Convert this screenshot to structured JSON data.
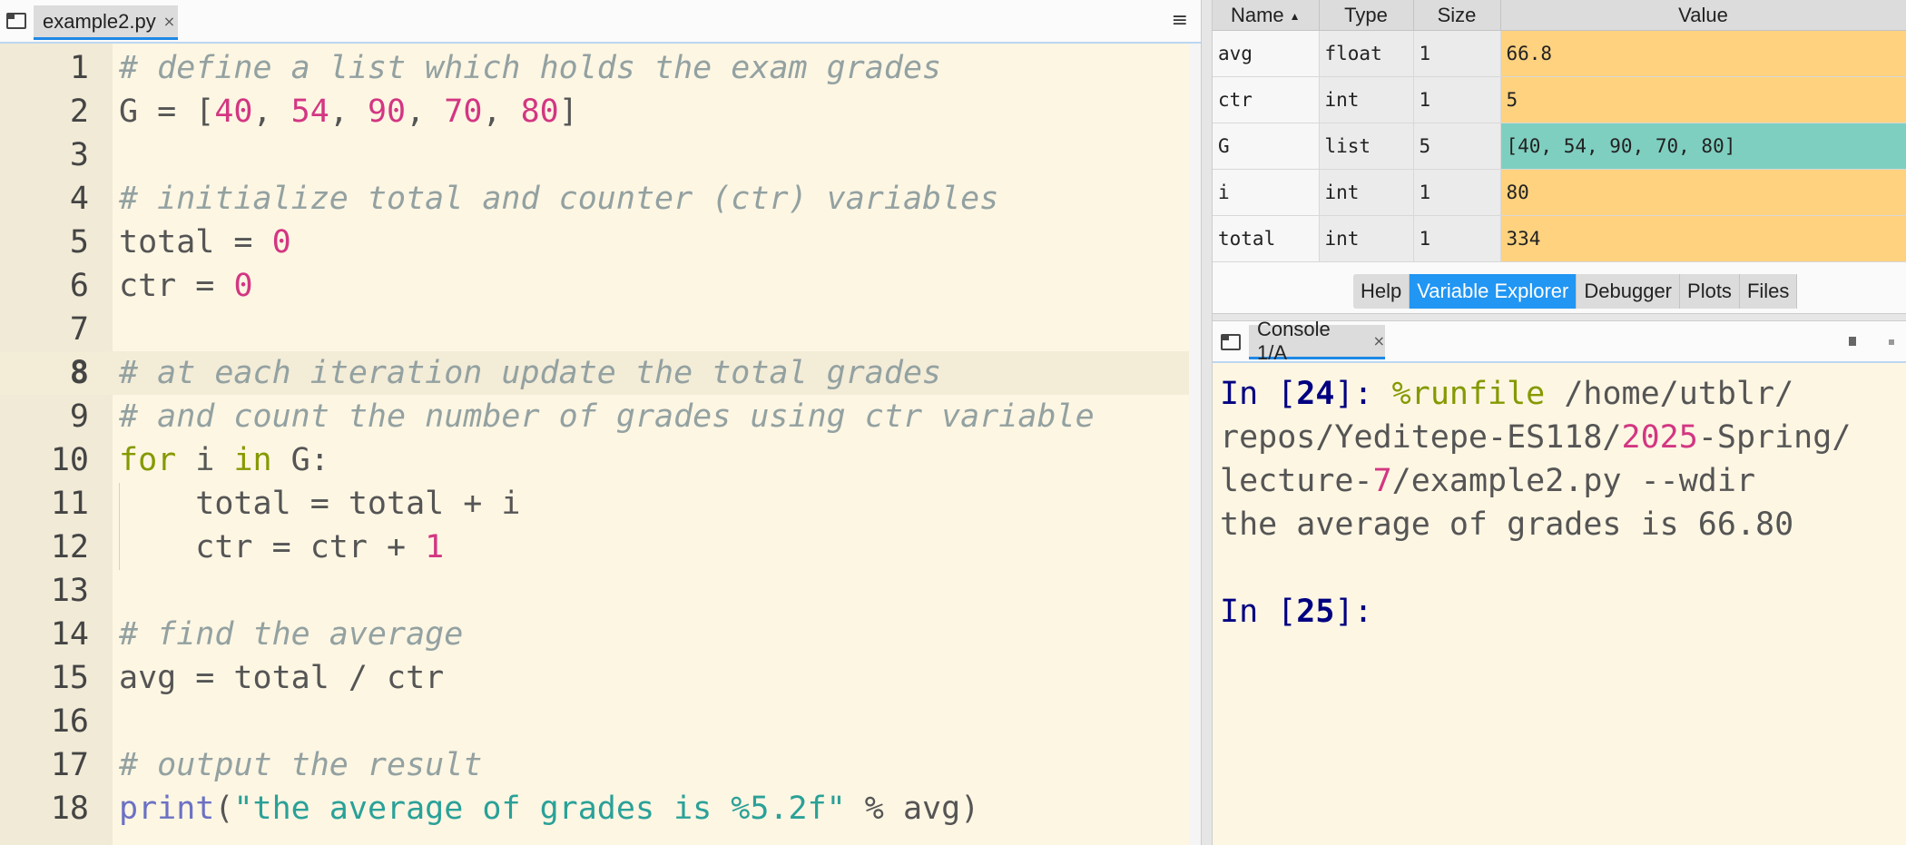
{
  "editor": {
    "tab_label": "example2.py",
    "tab_close": "×",
    "menu_icon": "≡",
    "current_line": 8,
    "lines": [
      {
        "n": "1",
        "segments": [
          {
            "t": "# define a list which holds the exam grades",
            "c": "cmt"
          }
        ]
      },
      {
        "n": "2",
        "segments": [
          {
            "t": "G = [",
            "c": ""
          },
          {
            "t": "40",
            "c": "num"
          },
          {
            "t": ", ",
            "c": ""
          },
          {
            "t": "54",
            "c": "num"
          },
          {
            "t": ", ",
            "c": ""
          },
          {
            "t": "90",
            "c": "num"
          },
          {
            "t": ", ",
            "c": ""
          },
          {
            "t": "70",
            "c": "num"
          },
          {
            "t": ", ",
            "c": ""
          },
          {
            "t": "80",
            "c": "num"
          },
          {
            "t": "]",
            "c": ""
          }
        ]
      },
      {
        "n": "3",
        "segments": []
      },
      {
        "n": "4",
        "segments": [
          {
            "t": "# initialize total and counter (ctr) variables",
            "c": "cmt"
          }
        ]
      },
      {
        "n": "5",
        "segments": [
          {
            "t": "total = ",
            "c": ""
          },
          {
            "t": "0",
            "c": "num"
          }
        ]
      },
      {
        "n": "6",
        "segments": [
          {
            "t": "ctr = ",
            "c": ""
          },
          {
            "t": "0",
            "c": "num"
          }
        ]
      },
      {
        "n": "7",
        "segments": []
      },
      {
        "n": "8",
        "segments": [
          {
            "t": "# at each iteration update the total grades",
            "c": "cmt"
          }
        ]
      },
      {
        "n": "9",
        "segments": [
          {
            "t": "# and count the number of grades using ctr variable",
            "c": "cmt"
          }
        ]
      },
      {
        "n": "10",
        "segments": [
          {
            "t": "for",
            "c": "kw"
          },
          {
            "t": " i ",
            "c": ""
          },
          {
            "t": "in",
            "c": "kw"
          },
          {
            "t": " G:",
            "c": ""
          }
        ]
      },
      {
        "n": "11",
        "segments": [
          {
            "t": "    total = total + i",
            "c": ""
          }
        ]
      },
      {
        "n": "12",
        "segments": [
          {
            "t": "    ctr = ctr + ",
            "c": ""
          },
          {
            "t": "1",
            "c": "num"
          }
        ]
      },
      {
        "n": "13",
        "segments": []
      },
      {
        "n": "14",
        "segments": [
          {
            "t": "# find the average",
            "c": "cmt"
          }
        ]
      },
      {
        "n": "15",
        "segments": [
          {
            "t": "avg = total / ctr",
            "c": ""
          }
        ]
      },
      {
        "n": "16",
        "segments": []
      },
      {
        "n": "17",
        "segments": [
          {
            "t": "# output the result",
            "c": "cmt"
          }
        ]
      },
      {
        "n": "18",
        "segments": [
          {
            "t": "print",
            "c": "fn"
          },
          {
            "t": "(",
            "c": ""
          },
          {
            "t": "\"the average of grades is %5.2f\"",
            "c": "str"
          },
          {
            "t": " % avg)",
            "c": ""
          }
        ]
      }
    ]
  },
  "variables": {
    "headers": {
      "name": "Name",
      "type": "Type",
      "size": "Size",
      "value": "Value"
    },
    "sort_indicator": "▲",
    "rows": [
      {
        "name": "avg",
        "type": "float",
        "size": "1",
        "value": "66.8",
        "color": "#ffd27f"
      },
      {
        "name": "ctr",
        "type": "int",
        "size": "1",
        "value": "5",
        "color": "#ffd27f"
      },
      {
        "name": "G",
        "type": "list",
        "size": "5",
        "value": "[40, 54, 90, 70, 80]",
        "color": "#7fcfc0"
      },
      {
        "name": "i",
        "type": "int",
        "size": "1",
        "value": "80",
        "color": "#ffd27f"
      },
      {
        "name": "total",
        "type": "int",
        "size": "1",
        "value": "334",
        "color": "#ffd27f"
      }
    ],
    "tabs": [
      {
        "label": "Help",
        "active": false
      },
      {
        "label": "Variable Explorer",
        "active": true
      },
      {
        "label": "Debugger",
        "active": false
      },
      {
        "label": "Plots",
        "active": false
      },
      {
        "label": "Files",
        "active": false
      }
    ]
  },
  "console": {
    "tab_label": "Console 1/A",
    "tab_close": "×",
    "lines": [
      {
        "segments": [
          {
            "t": "In [",
            "c": "prompt"
          },
          {
            "t": "24",
            "c": "prompt-b"
          },
          {
            "t": "]: ",
            "c": "prompt"
          },
          {
            "t": "%runfile",
            "c": "kw"
          },
          {
            "t": " /home/utblr/",
            "c": ""
          }
        ]
      },
      {
        "segments": [
          {
            "t": "repos/Yeditepe-ES118/",
            "c": ""
          },
          {
            "t": "2025",
            "c": "num"
          },
          {
            "t": "-Spring/",
            "c": ""
          }
        ]
      },
      {
        "segments": [
          {
            "t": "lecture-",
            "c": ""
          },
          {
            "t": "7",
            "c": "num"
          },
          {
            "t": "/example2.py --wdir",
            "c": ""
          }
        ]
      },
      {
        "segments": [
          {
            "t": "the average of grades is 66.80",
            "c": ""
          }
        ]
      },
      {
        "segments": []
      },
      {
        "segments": [
          {
            "t": "In [",
            "c": "prompt"
          },
          {
            "t": "25",
            "c": "prompt-b"
          },
          {
            "t": "]:",
            "c": "prompt"
          }
        ]
      }
    ]
  }
}
